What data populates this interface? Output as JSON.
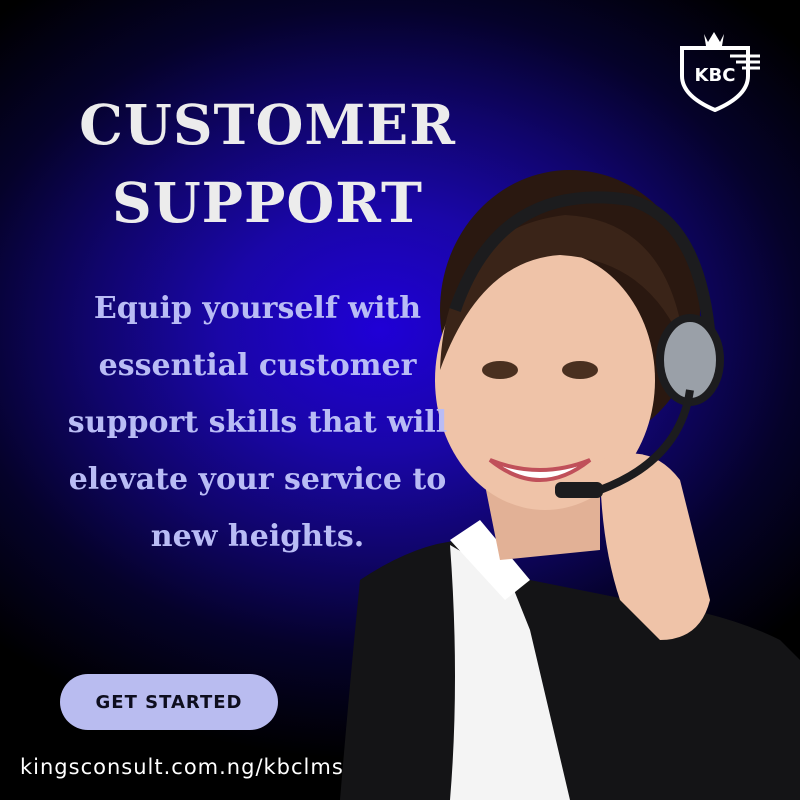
{
  "headline": {
    "line1": "CUSTOMER",
    "line2": "SUPPORT"
  },
  "description": "Equip yourself with essential customer support skills that will elevate your service to new heights.",
  "cta_label": "GET STARTED",
  "url": "kingsconsult.com.ng/kbclms",
  "logo_text": "KBC",
  "colors": {
    "background_center": "#1f00d6",
    "background_edge": "#000000",
    "headline": "#ececec",
    "description": "#b9bcf5",
    "button_bg": "#b9bcf0",
    "button_text": "#0e0e1e"
  }
}
